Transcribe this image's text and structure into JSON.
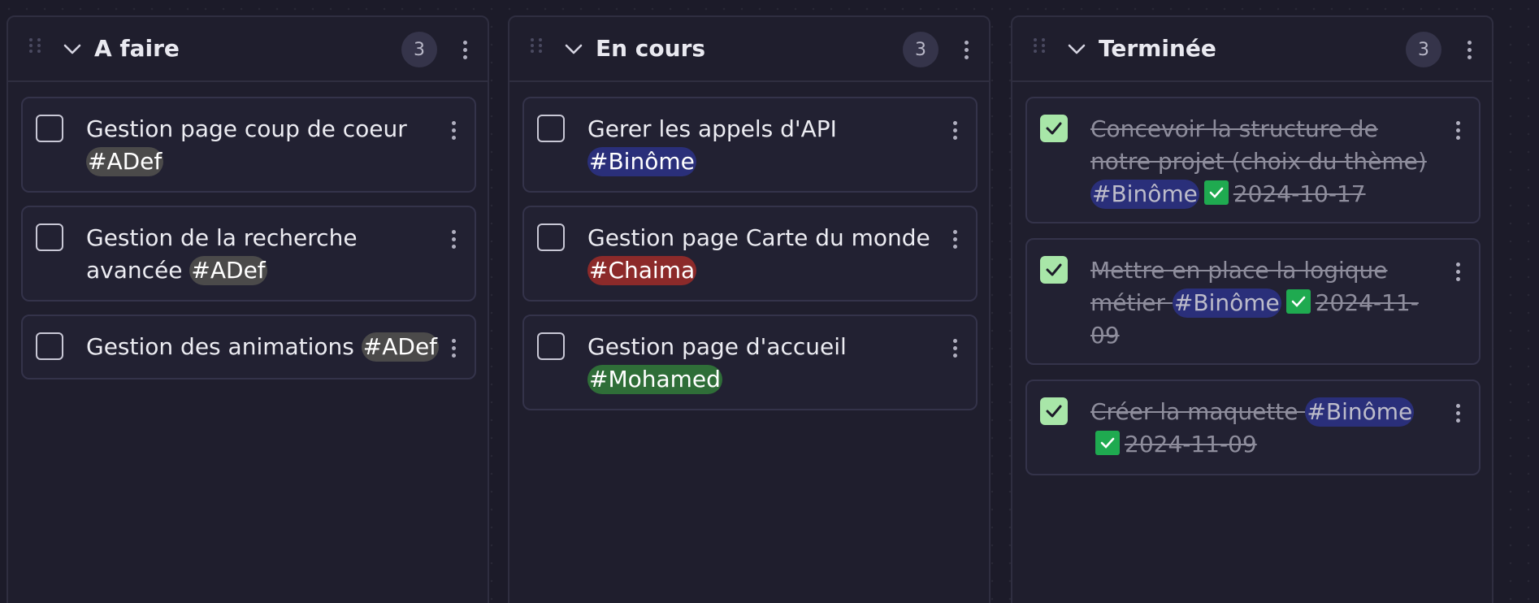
{
  "columns": [
    {
      "title": "A faire",
      "count": "3",
      "cards": [
        {
          "text": "Gestion page coup de coeur ",
          "tag": "#ADef",
          "tag_kind": "adef",
          "done": false
        },
        {
          "text": "Gestion de la recherche avancée ",
          "tag": "#ADef",
          "tag_kind": "adef",
          "done": false
        },
        {
          "text": "Gestion des animations ",
          "tag": "#ADef",
          "tag_kind": "adef",
          "done": false
        }
      ]
    },
    {
      "title": "En cours",
      "count": "3",
      "cards": [
        {
          "text": "Gerer les appels d'API ",
          "tag": "#Binôme",
          "tag_kind": "binome",
          "done": false
        },
        {
          "text": "Gestion page Carte du monde ",
          "tag": "#Chaima",
          "tag_kind": "chaima",
          "done": false
        },
        {
          "text": "Gestion page d'accueil ",
          "tag": "#Mohamed",
          "tag_kind": "mohamed",
          "done": false
        }
      ]
    },
    {
      "title": "Terminée",
      "count": "3",
      "cards": [
        {
          "text": "Concevoir la structure de notre projet (choix du thème) ",
          "tag": "#Binôme",
          "tag_kind": "binome",
          "done": true,
          "date": "2024-10-17"
        },
        {
          "text": "Mettre en place la logique métier ",
          "tag": "#Binôme",
          "tag_kind": "binome",
          "done": true,
          "date": "2024-11-09"
        },
        {
          "text": "Créer la maquette ",
          "tag": "#Binôme",
          "tag_kind": "binome",
          "done": true,
          "date": "2024-11-09"
        }
      ]
    }
  ],
  "icons": {
    "drag": "drag-handle-icon",
    "collapse": "chevron-down-icon",
    "menu": "more-vertical-icon",
    "done": "checkmark-icon"
  },
  "colors": {
    "tag_adef": "#4b4a4a",
    "tag_binome": "#2a2f7a",
    "tag_chaima": "#8c2a2a",
    "tag_mohamed": "#2f6e38",
    "checkbox_done": "#a8e6a8",
    "done_badge": "#1faa50"
  }
}
